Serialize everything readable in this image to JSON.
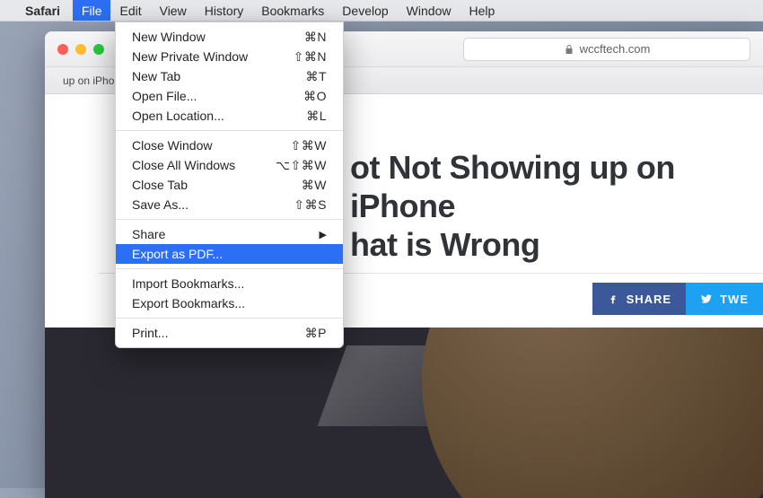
{
  "menubar": {
    "app": "Safari",
    "items": [
      "File",
      "Edit",
      "View",
      "History",
      "Bookmarks",
      "Develop",
      "Window",
      "Help"
    ],
    "active_index": 0
  },
  "addressbar": {
    "domain": "wccftech.com"
  },
  "tab": {
    "title": "up on iPhone, iPad? Here's What is Wrong"
  },
  "page": {
    "headline_line1": "ot Not Showing up on iPhone",
    "headline_line2": "hat is Wrong",
    "share_label": "SHARE",
    "tweet_label": "TWE"
  },
  "file_menu": {
    "group1": [
      {
        "label": "New Window",
        "shortcut": "⌘N"
      },
      {
        "label": "New Private Window",
        "shortcut": "⇧⌘N"
      },
      {
        "label": "New Tab",
        "shortcut": "⌘T"
      },
      {
        "label": "Open File...",
        "shortcut": "⌘O"
      },
      {
        "label": "Open Location...",
        "shortcut": "⌘L"
      }
    ],
    "group2": [
      {
        "label": "Close Window",
        "shortcut": "⇧⌘W"
      },
      {
        "label": "Close All Windows",
        "shortcut": "⌥⇧⌘W"
      },
      {
        "label": "Close Tab",
        "shortcut": "⌘W"
      },
      {
        "label": "Save As...",
        "shortcut": "⇧⌘S"
      }
    ],
    "share": {
      "label": "Share"
    },
    "export_pdf": {
      "label": "Export as PDF..."
    },
    "group3": [
      {
        "label": "Import Bookmarks..."
      },
      {
        "label": "Export Bookmarks..."
      }
    ],
    "print": {
      "label": "Print...",
      "shortcut": "⌘P"
    }
  }
}
